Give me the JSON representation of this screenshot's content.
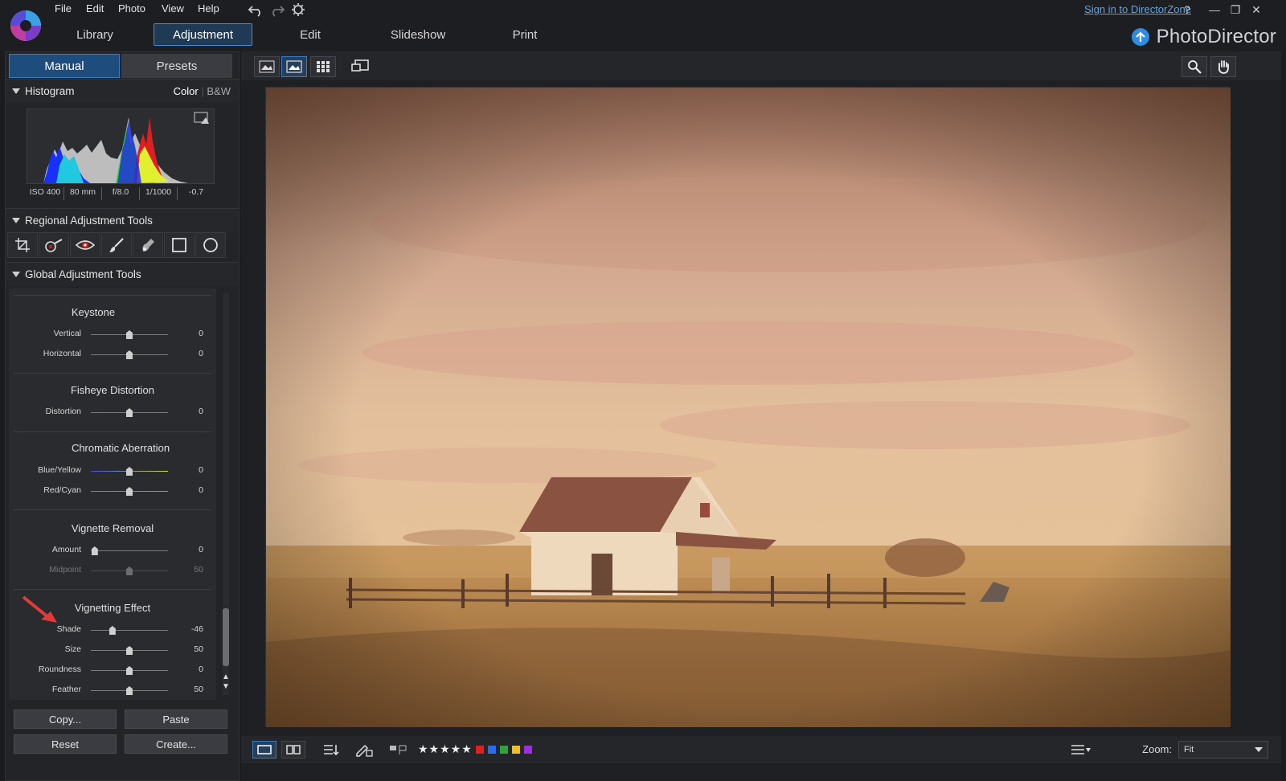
{
  "menu": [
    "File",
    "Edit",
    "Photo",
    "View",
    "Help"
  ],
  "tabs": [
    {
      "label": "Library",
      "active": false
    },
    {
      "label": "Adjustment",
      "active": true
    },
    {
      "label": "Edit",
      "active": false
    },
    {
      "label": "Slideshow",
      "active": false
    },
    {
      "label": "Print",
      "active": false
    }
  ],
  "header": {
    "signin": "Sign in to DirectorZone",
    "help": "?",
    "brand": "PhotoDirector",
    "accent": "#3c8fd6"
  },
  "panel": {
    "tab_manual": "Manual",
    "tab_presets": "Presets",
    "histogram": {
      "title": "Histogram",
      "color_label": "Color",
      "bw_label": "B&W",
      "exif": [
        "ISO 400",
        "80 mm",
        "f/8.0",
        "1/1000",
        "-0.7"
      ]
    },
    "regional_title": "Regional Adjustment Tools",
    "regional_tools": [
      "crop-icon",
      "red-eye-brush-icon",
      "eye-icon",
      "brush-icon",
      "spot-removal-icon",
      "rectangle-icon",
      "circle-icon"
    ],
    "global_title": "Global Adjustment Tools",
    "groups": [
      {
        "title": "Keystone",
        "sliders": [
          {
            "label": "Vertical",
            "value": "0",
            "pos": 0.5
          },
          {
            "label": "Horizontal",
            "value": "0",
            "pos": 0.5
          }
        ]
      },
      {
        "title": "Fisheye Distortion",
        "sliders": [
          {
            "label": "Distortion",
            "value": "0",
            "pos": 0.5
          }
        ]
      },
      {
        "title": "Chromatic Aberration",
        "sliders": [
          {
            "label": "Blue/Yellow",
            "value": "0",
            "pos": 0.5
          },
          {
            "label": "Red/Cyan",
            "value": "0",
            "pos": 0.5
          }
        ]
      },
      {
        "title": "Vignette Removal",
        "sliders": [
          {
            "label": "Amount",
            "value": "0",
            "pos": 0.05
          },
          {
            "label": "Midpoint",
            "value": "50",
            "pos": 0.5,
            "disabled": true
          }
        ]
      },
      {
        "title": "Vignetting Effect",
        "sliders": [
          {
            "label": "Shade",
            "value": "-46",
            "pos": 0.28
          },
          {
            "label": "Size",
            "value": "50",
            "pos": 0.5
          },
          {
            "label": "Roundness",
            "value": "0",
            "pos": 0.5
          },
          {
            "label": "Feather",
            "value": "50",
            "pos": 0.5
          }
        ]
      }
    ],
    "buttons": {
      "copy": "Copy...",
      "paste": "Paste",
      "reset": "Reset",
      "create": "Create..."
    }
  },
  "bottombar": {
    "stars": "★★★★★",
    "color_labels": [
      "#e02020",
      "#2a6cf0",
      "#2da53a",
      "#f0c020",
      "#9a30e0"
    ],
    "zoom_label": "Zoom:",
    "zoom_value": "Fit"
  }
}
